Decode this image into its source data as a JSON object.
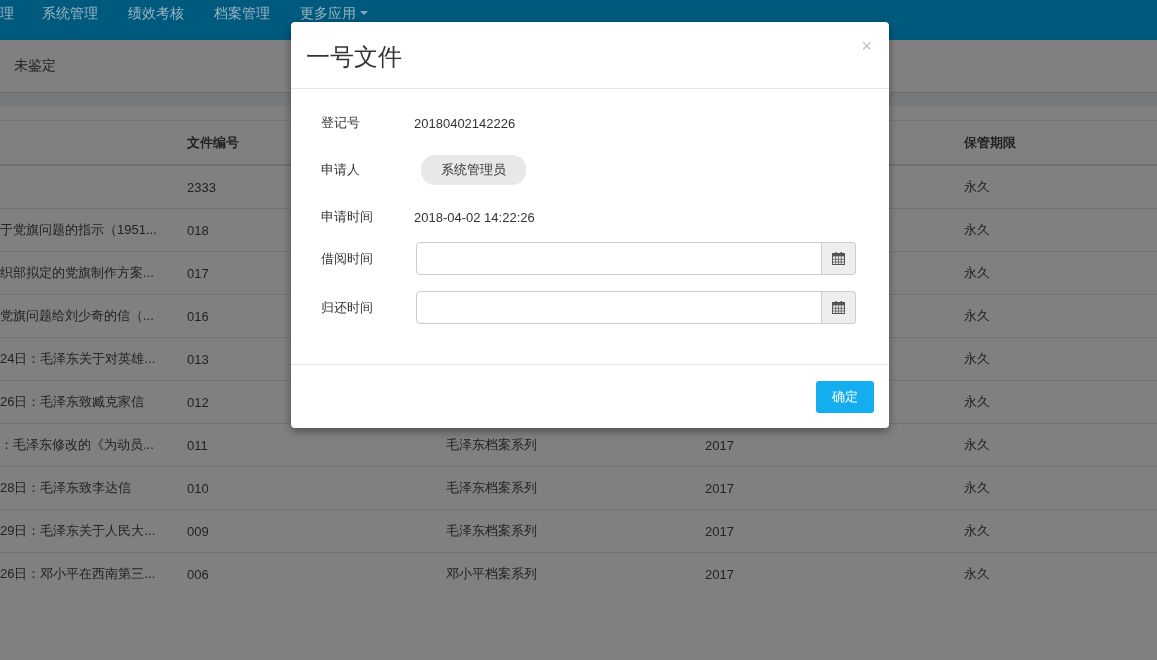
{
  "nav": {
    "items": [
      {
        "label": "理",
        "dropdown": false
      },
      {
        "label": "系统管理",
        "dropdown": false
      },
      {
        "label": "绩效考核",
        "dropdown": false
      },
      {
        "label": "档案管理",
        "dropdown": false
      },
      {
        "label": "更多应用",
        "dropdown": true
      }
    ]
  },
  "filter_bar": {
    "label": "未鉴定"
  },
  "table": {
    "columns": [
      {},
      {
        "label": "文件编号"
      },
      {},
      {},
      {
        "label": "保管期限"
      }
    ],
    "rows": [
      {
        "cells": [
          "",
          "2333",
          "",
          "",
          "永久"
        ]
      },
      {
        "cells": [
          "于党旗问题的指示（1951...",
          "018",
          "",
          "",
          "永久"
        ]
      },
      {
        "cells": [
          "织部拟定的党旗制作方案...",
          "017",
          "",
          "",
          "永久"
        ]
      },
      {
        "cells": [
          "党旗问题给刘少奇的信（...",
          "016",
          "",
          "",
          "永久"
        ]
      },
      {
        "cells": [
          "24日：毛泽东关于对英雄...",
          "013",
          "",
          "",
          "永久"
        ]
      },
      {
        "cells": [
          "26日：毛泽东致臧克家信",
          "012",
          "",
          "",
          "永久"
        ]
      },
      {
        "cells": [
          "：毛泽东修改的《为动员...",
          "011",
          "毛泽东档案系列",
          "2017",
          "永久"
        ]
      },
      {
        "cells": [
          "28日：毛泽东致李达信",
          "010",
          "毛泽东档案系列",
          "2017",
          "永久"
        ]
      },
      {
        "cells": [
          "29日：毛泽东关于人民大...",
          "009",
          "毛泽东档案系列",
          "2017",
          "永久"
        ]
      },
      {
        "cells": [
          "26日：邓小平在西南第三...",
          "006",
          "邓小平档案系列",
          "2017",
          "永久"
        ]
      }
    ]
  },
  "modal": {
    "title": "一号文件",
    "close": "×",
    "fields": [
      {
        "label": "登记号",
        "kind": "text",
        "value": "20180402142226"
      },
      {
        "label": "申请人",
        "kind": "tag",
        "value": "系统管理员"
      },
      {
        "label": "申请时间",
        "kind": "text",
        "value": "2018-04-02 14:22:26"
      },
      {
        "label": "借阅时间",
        "kind": "date"
      },
      {
        "label": "归还时间",
        "kind": "date"
      }
    ],
    "confirm": "确定"
  }
}
